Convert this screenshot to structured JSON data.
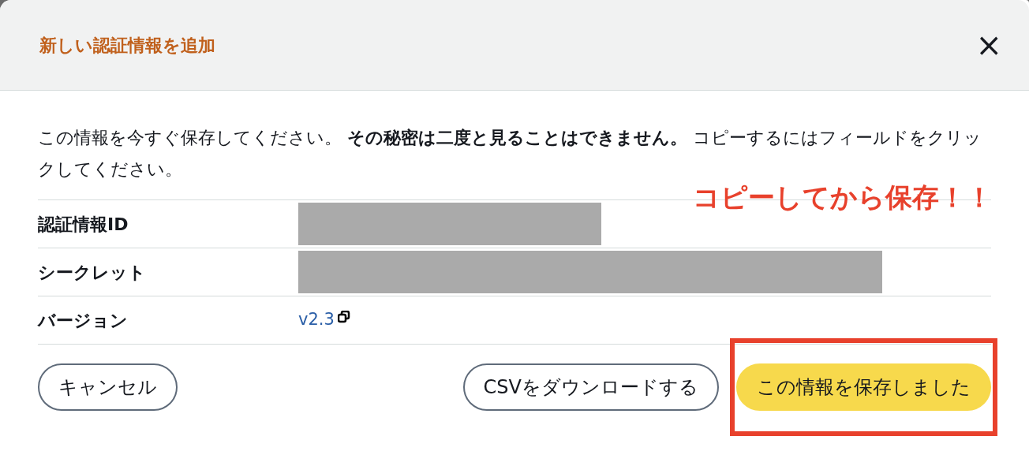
{
  "dialog": {
    "title": "新しい認証情報を追加",
    "close": "×"
  },
  "message": "この情報を今すぐ保存してください。 **その秘密は二度と見ることはできません。** コピーするにはフィールドをクリックしてください。",
  "annotation": "コピーしてから保存！！",
  "fields": [
    {
      "label": "認証情報ID",
      "kind": "redacted"
    },
    {
      "label": "シークレット",
      "kind": "redacted"
    },
    {
      "label": "バージョン",
      "kind": "link",
      "value": "v2.3"
    }
  ],
  "buttons": [
    {
      "label": "キャンセル",
      "kind": "normal"
    },
    {
      "label": "CSVをダウンロードする",
      "kind": "normal"
    },
    {
      "label": "この情報を保存しました",
      "kind": "primary",
      "highlighted": true
    }
  ]
}
